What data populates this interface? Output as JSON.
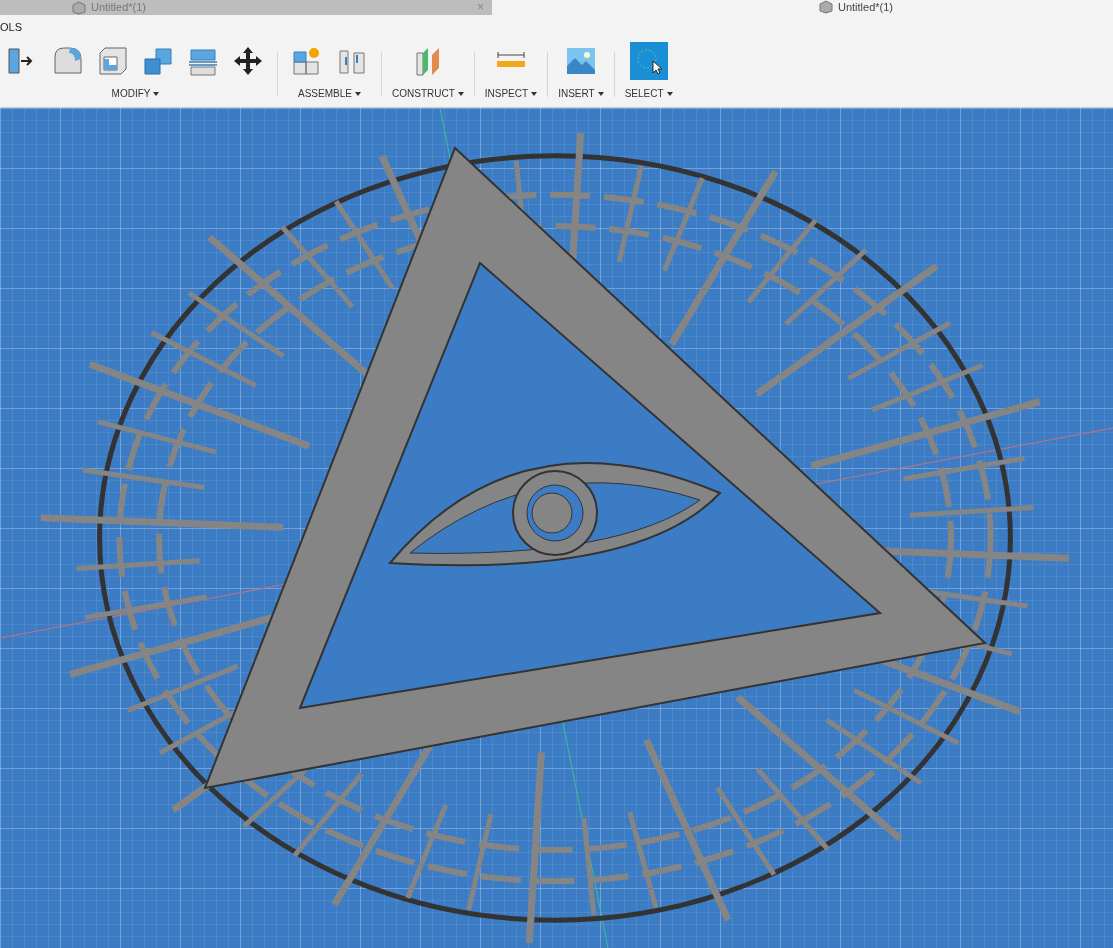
{
  "tab_bar": {
    "tabs": [
      {
        "title": "Untitled*(1)",
        "selected": false,
        "close": "×"
      }
    ]
  },
  "document_title": "Untitled*(1)",
  "ribbon_tab": "OLS",
  "groups": [
    {
      "label": "MODIFY",
      "tools": [
        {
          "kind": "press-pull"
        },
        {
          "kind": "fillet"
        },
        {
          "kind": "shell"
        },
        {
          "kind": "combine"
        },
        {
          "kind": "split"
        },
        {
          "kind": "move"
        }
      ]
    },
    {
      "label": "ASSEMBLE",
      "tools": [
        {
          "kind": "new-component"
        },
        {
          "kind": "joint"
        }
      ]
    },
    {
      "label": "CONSTRUCT",
      "tools": [
        {
          "kind": "plane"
        }
      ]
    },
    {
      "label": "INSPECT",
      "tools": [
        {
          "kind": "measure"
        }
      ]
    },
    {
      "label": "INSERT",
      "tools": [
        {
          "kind": "image"
        }
      ]
    },
    {
      "label": "SELECT",
      "tools": [
        {
          "kind": "select"
        }
      ]
    }
  ]
}
